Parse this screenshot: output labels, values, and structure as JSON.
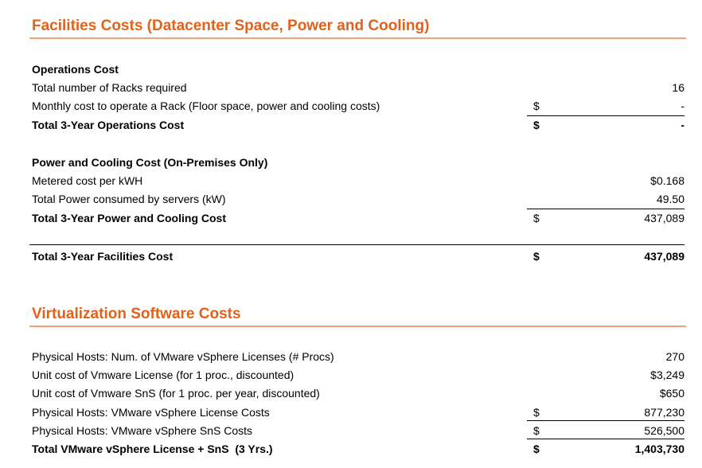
{
  "facilities": {
    "title": "Facilities Costs (Datacenter Space, Power and Cooling)",
    "operations": {
      "header": "Operations Cost",
      "rows": [
        {
          "label": "Total number of Racks required",
          "currency": "",
          "value": "16"
        },
        {
          "label": "Monthly cost to operate a Rack (Floor space, power and cooling costs)",
          "currency": "$",
          "value": "-"
        },
        {
          "label": "Total 3-Year Operations Cost",
          "currency": "$",
          "value": "-"
        }
      ]
    },
    "power": {
      "header": "Power and Cooling Cost (On-Premises Only)",
      "rows": [
        {
          "label": "Metered cost per kWH",
          "currency": "",
          "value": "$0.168"
        },
        {
          "label": "Total Power consumed by servers (kW)",
          "currency": "",
          "value": "49.50"
        },
        {
          "label": "Total 3-Year Power and Cooling Cost",
          "currency": "$",
          "value": "437,089"
        }
      ]
    },
    "total": {
      "label": "Total 3-Year Facilities Cost",
      "currency": "$",
      "value": "437,089"
    }
  },
  "virtualization": {
    "title": "Virtualization Software Costs",
    "rows": [
      {
        "label": "Physical Hosts: Num. of VMware vSphere Licenses (# Procs)",
        "currency": "",
        "value": "270"
      },
      {
        "label": "Unit cost of Vmware License (for 1 proc., discounted)",
        "currency": "",
        "value": "$3,249"
      },
      {
        "label": "Unit cost of Vmware SnS (for 1 proc. per year, discounted)",
        "currency": "",
        "value": "$650"
      },
      {
        "label": "Physical Hosts: VMware vSphere License Costs",
        "currency": "$",
        "value": "877,230"
      },
      {
        "label": "Physical Hosts: VMware vSphere SnS Costs",
        "currency": "$",
        "value": "526,500"
      },
      {
        "label": "Total VMware vSphere License + SnS  (3 Yrs.)",
        "currency": "$",
        "value": "1,403,730"
      }
    ]
  },
  "colors": {
    "section_title": "#e2621b",
    "title_rule": "#f1a277",
    "text": "#000000"
  }
}
